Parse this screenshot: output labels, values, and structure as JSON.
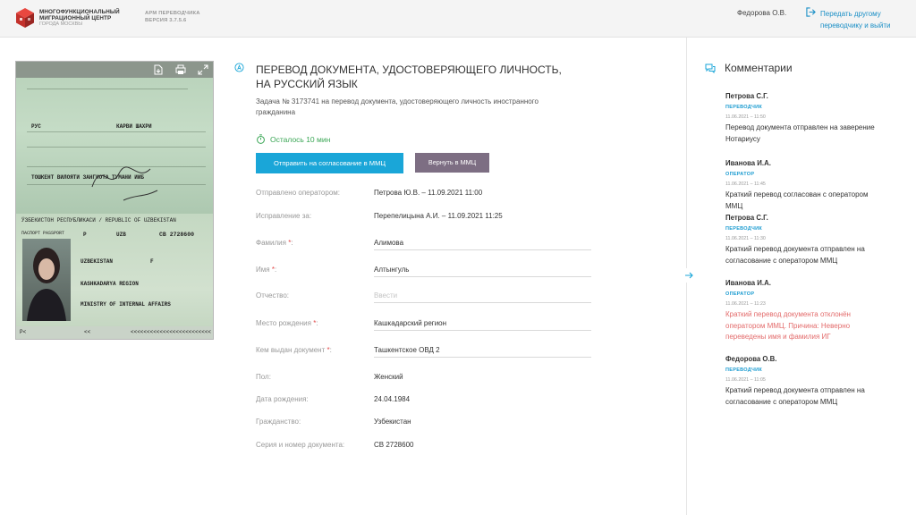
{
  "header": {
    "org_line1": "МНОГОФУНКЦИОНАЛЬНЫЙ",
    "org_line2": "МИГРАЦИОННЫЙ ЦЕНТР",
    "org_line3": "ГОРОДА МОСКВЫ",
    "app_name": "АРМ ПЕРЕВОДЧИКА",
    "app_version": "ВЕРСИЯ 3.7.5.6",
    "user_name": "Федорова О.В.",
    "logout_line1": "Передать другому",
    "logout_line2": "переводчику и выйти"
  },
  "document_preview": {
    "toolbar_icons": [
      "download-icon",
      "print-icon",
      "expand-icon"
    ],
    "mrz_left": "P<",
    "mrz_mid": "<<",
    "mrz_right": "<<<<<<<<<<<<<<<<<<<<<<<<<"
  },
  "task": {
    "title_line1": "ПЕРЕВОД ДОКУМЕНТА, УДОСТОВЕРЯЮЩЕГО ЛИЧНОСТЬ,",
    "title_line2": "НА РУССКИЙ ЯЗЫК",
    "subtitle": "Задача № 3173741 на перевод документа, удостоверяющего личность иностранного гражданина",
    "timer": "Осталось 10 мин",
    "send_button": "Отправить на согласование в ММЦ",
    "return_button": "Вернуть в ММЦ"
  },
  "fields": {
    "sent_label": "Отправлено оператором:",
    "sent_value": "Петрова Ю.В. – 11.09.2021   11:00",
    "fix_label": "Исправление за:",
    "fix_value": "Перепелицына А.И. – 11.09.2021   11:25",
    "surname_label": "Фамилия",
    "surname_value": "Алимова",
    "name_label": "Имя",
    "name_value": "Алтынгуль",
    "patronymic_label": "Отчество:",
    "patronymic_placeholder": "Ввести",
    "birthplace_label": "Место рождения",
    "birthplace_value": "Кашкадарский регион",
    "issuer_label": "Кем выдан документ",
    "issuer_value": "Ташкентское ОВД 2",
    "gender_label": "Пол:",
    "gender_value": "Женский",
    "birthdate_label": "Дата рождения:",
    "birthdate_value": "24.04.1984",
    "citizenship_label": "Гражданство:",
    "citizenship_value": "Узбекистан",
    "docnum_label": "Серия и номер документа:",
    "docnum_value": "СВ 2728600",
    "required_mark": "*",
    "colon": ":"
  },
  "comments": {
    "title": "Комментарии",
    "items": [
      {
        "author": "Петрова С.Г.",
        "role": "ПЕРЕВОДЧИК",
        "time": "11.06.2021 – 11:50",
        "text": "Перевод документа отправлен на заверение Нотариусу"
      },
      {
        "author": "Иванова И.А.",
        "role": "ОПЕРАТОР",
        "time": "11.06.2021 – 11:45",
        "text": "Краткий перевод согласован с оператором ММЦ"
      },
      {
        "author": "Петрова С.Г.",
        "role": "ПЕРЕВОДЧИК",
        "time": "11.06.2021 – 11:30",
        "text": "Краткий перевод документа отправлен на согласование с оператором ММЦ"
      },
      {
        "author": "Иванова И.А.",
        "role": "ОПЕРАТОР",
        "time": "11.06.2021 – 11:23",
        "text": "Краткий перевод документа отклонён оператором ММЦ. Причина: Неверно переведены имя и фамилия ИГ"
      },
      {
        "author": "Федорова О.В.",
        "role": "ПЕРЕВОДЧИК",
        "time": "11.06.2021 – 11:05",
        "text": "Краткий перевод документа отправлен на согласование с оператором ММЦ"
      }
    ]
  },
  "colors": {
    "accent": "#1aa6d8",
    "timer_green": "#3aa655",
    "return_button": "#7d6e83",
    "rejected_text": "#e36b6b"
  }
}
